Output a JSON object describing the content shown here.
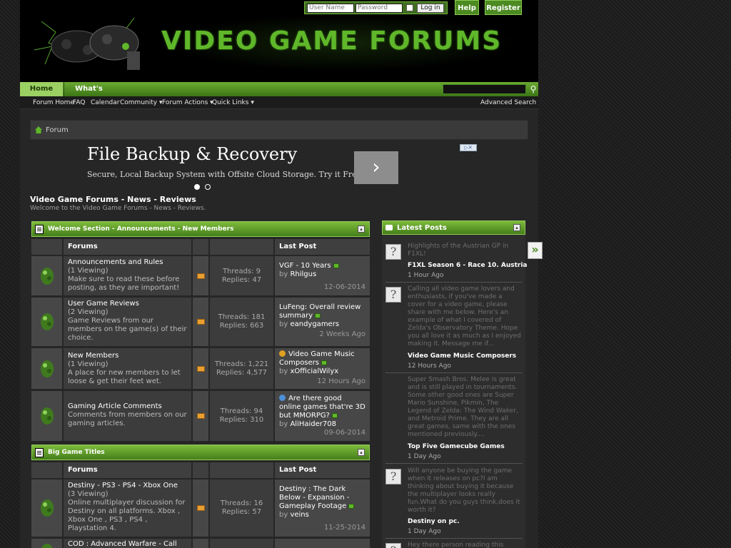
{
  "login": {
    "username_placeholder": "User Name",
    "password_placeholder": "Password",
    "login_button": "Log in",
    "help": "Help",
    "register": "Register"
  },
  "logo": {
    "text": "VIDEO GAME FORUMS"
  },
  "navbar": {
    "tabs": [
      "Home",
      "What's New?"
    ],
    "subnav": [
      "Forum Home",
      "FAQ",
      "Calendar",
      "Community",
      "Forum Actions",
      "Quick Links"
    ],
    "advanced_search": "Advanced Search"
  },
  "breadcrumb": {
    "label": "Forum"
  },
  "ad": {
    "title": "File Backup & Recovery",
    "subtitle": "Secure, Local Backup System with Offsite Cloud Storage. Try it Free!",
    "next": "›"
  },
  "page": {
    "title": "Video Game Forums - News - Reviews",
    "description": "Welcome to the Video Game Forums - News - Reviews."
  },
  "columns": {
    "forums": "Forums",
    "last_post": "Last Post"
  },
  "categories": [
    {
      "title": "Welcome Section - Announcements - New Members",
      "forums": [
        {
          "name": "Announcements and Rules",
          "viewing": "(1 Viewing)",
          "description": "Make sure to read these before posting, as they are important!",
          "threads": "Threads: 9",
          "replies": "Replies: 47",
          "last_title": "VGF - 10 Years",
          "last_by": "by",
          "last_user": "Rhilgus",
          "last_date": "12-06-2014"
        },
        {
          "name": "User Game Reviews",
          "viewing": "(2 Viewing)",
          "description": "Game Reviews from our members on the game(s) of their choice.",
          "threads": "Threads: 181",
          "replies": "Replies: 663",
          "last_title": "LuFeng: Overall review summary",
          "last_by": "by",
          "last_user": "eandygamers",
          "last_date": "2 Weeks Ago"
        },
        {
          "name": "New Members",
          "viewing": "(1 Viewing)",
          "description": "A place for new members to let loose & get their feet wet.",
          "threads": "Threads: 1,221",
          "replies": "Replies: 4,577",
          "last_title": "Video Game Music Composers",
          "last_by": "by",
          "last_user": "xOfficialWilyx",
          "last_date": "12 Hours Ago"
        },
        {
          "name": "Gaming Article Comments",
          "viewing": "",
          "description": "Comments from members on our gaming articles.",
          "threads": "Threads: 94",
          "replies": "Replies: 310",
          "last_title": "Are there good online games that're 3D but MMORPG?",
          "last_by": "by",
          "last_user": "AliHaider708",
          "last_date": "09-06-2014"
        }
      ]
    },
    {
      "title": "Big Game Titles",
      "forums": [
        {
          "name": "Destiny - PS3 - PS4 - Xbox One",
          "viewing": "(3 Viewing)",
          "description": "Online multiplayer discussion for Destiny on all platforms. Xbox , Xbox One , PS3 , PS4 , Playstation 4.",
          "threads": "Threads: 16",
          "replies": "Replies: 57",
          "last_title": "Destiny : The Dark Below - Expansion - Gameplay Footage",
          "last_by": "by",
          "last_user": "veins",
          "last_date": "11-25-2014"
        },
        {
          "name": "COD : Advanced Warfare - Call Of",
          "viewing": "",
          "description": "",
          "threads": "",
          "replies": "",
          "last_title": "",
          "last_by": "",
          "last_user": "",
          "last_date": ""
        }
      ]
    }
  ],
  "latest_posts": {
    "title": "Latest Posts",
    "items": [
      {
        "text": "Highlights of the Austrian GP in F1XL!",
        "thread": "F1XL Season 6 - Race 10. Austria",
        "time": "1 Hour Ago"
      },
      {
        "text": "Calling all video game lovers and enthusiasts, if you've made a cover for a video game, please share with me below. Here's an example of what I covered of Zelda's Observatory Theme. Hope you all love it as much as I enjoyed making it. Message me if...",
        "thread": "Video Game Music Composers",
        "time": "12 Hours Ago"
      },
      {
        "text": "Super Smash Bros. Melee is great and is still played in tournaments. Some other good ones are Super Mario Sunshine, Pikmin, The Legend of Zelda: The Wind Waker, and Metroid Prime. They are all great games, same with the ones mentioned previously....",
        "thread": "Top Five Gamecube Games",
        "time": "1 Day Ago"
      },
      {
        "text": "Will anyone be buying the game when it releases on pc?I am thinking about buying it because the multiplayer looks really fun.What do you guys think,does it worth it?",
        "thread": "Destiny on pc.",
        "time": "1 Day Ago"
      },
      {
        "text": "Hey there person reading this",
        "thread": "",
        "time": ""
      }
    ]
  },
  "colors": {
    "accent": "#5fb72a",
    "nav_active": "#9bd062",
    "background": "#262626"
  }
}
